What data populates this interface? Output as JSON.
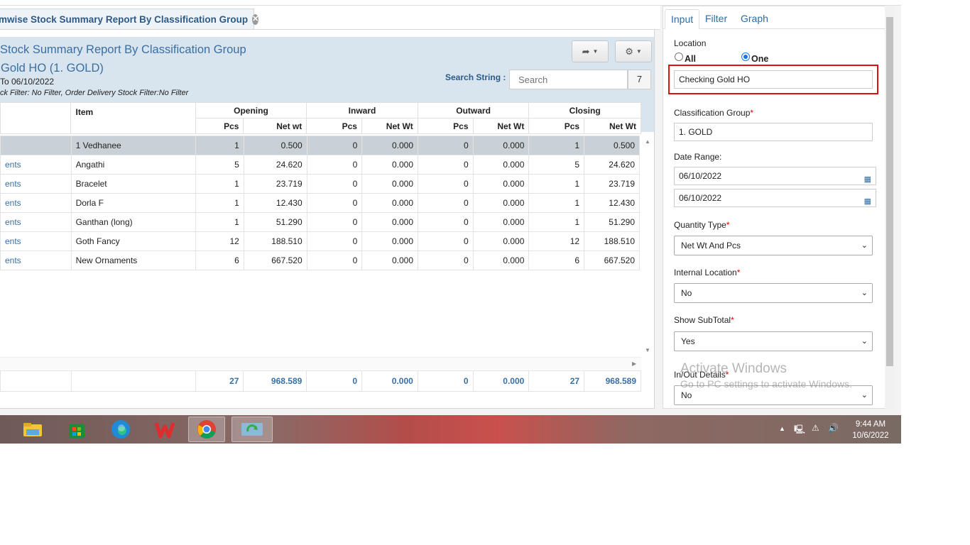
{
  "tab": {
    "label": "mwise Stock Summary Report By Classification Group"
  },
  "report": {
    "title": "Stock Summary Report By Classification Group",
    "subtitle": "Gold HO (1. GOLD)",
    "date_range": "To 06/10/2022",
    "filter_text": "ck Filter: No Filter, Order Delivery Stock Filter:No Filter",
    "search_label": "Search String :",
    "search_placeholder": "Search",
    "search_count": "7"
  },
  "table": {
    "col_item": "Item",
    "groups": [
      "Opening",
      "Inward",
      "Outward",
      "Closing"
    ],
    "sub": {
      "pcs": "Pcs",
      "netwt_opening": "Net wt",
      "netwt": "Net Wt"
    },
    "rows": [
      {
        "group": "",
        "item": "1 Vedhanee",
        "op_pcs": "1",
        "op_wt": "0.500",
        "in_pcs": "0",
        "in_wt": "0.000",
        "out_pcs": "0",
        "out_wt": "0.000",
        "cl_pcs": "1",
        "cl_wt": "0.500"
      },
      {
        "group": "ents",
        "item": "Angathi",
        "op_pcs": "5",
        "op_wt": "24.620",
        "in_pcs": "0",
        "in_wt": "0.000",
        "out_pcs": "0",
        "out_wt": "0.000",
        "cl_pcs": "5",
        "cl_wt": "24.620"
      },
      {
        "group": "ents",
        "item": "Bracelet",
        "op_pcs": "1",
        "op_wt": "23.719",
        "in_pcs": "0",
        "in_wt": "0.000",
        "out_pcs": "0",
        "out_wt": "0.000",
        "cl_pcs": "1",
        "cl_wt": "23.719"
      },
      {
        "group": "ents",
        "item": "Dorla F",
        "op_pcs": "1",
        "op_wt": "12.430",
        "in_pcs": "0",
        "in_wt": "0.000",
        "out_pcs": "0",
        "out_wt": "0.000",
        "cl_pcs": "1",
        "cl_wt": "12.430"
      },
      {
        "group": "ents",
        "item": "Ganthan (long)",
        "op_pcs": "1",
        "op_wt": "51.290",
        "in_pcs": "0",
        "in_wt": "0.000",
        "out_pcs": "0",
        "out_wt": "0.000",
        "cl_pcs": "1",
        "cl_wt": "51.290"
      },
      {
        "group": "ents",
        "item": "Goth Fancy",
        "op_pcs": "12",
        "op_wt": "188.510",
        "in_pcs": "0",
        "in_wt": "0.000",
        "out_pcs": "0",
        "out_wt": "0.000",
        "cl_pcs": "12",
        "cl_wt": "188.510"
      },
      {
        "group": "ents",
        "item": "New Ornaments",
        "op_pcs": "6",
        "op_wt": "667.520",
        "in_pcs": "0",
        "in_wt": "0.000",
        "out_pcs": "0",
        "out_wt": "0.000",
        "cl_pcs": "6",
        "cl_wt": "667.520"
      }
    ],
    "totals": {
      "op_pcs": "27",
      "op_wt": "968.589",
      "in_pcs": "0",
      "in_wt": "0.000",
      "out_pcs": "0",
      "out_wt": "0.000",
      "cl_pcs": "27",
      "cl_wt": "968.589"
    }
  },
  "panel": {
    "tabs": [
      "Input",
      "Filter",
      "Graph"
    ],
    "location_label": "Location",
    "radio_all": "All",
    "radio_one": "One",
    "location_value": "Checking Gold HO",
    "classification_label": "Classification Group",
    "classification_value": "1. GOLD",
    "date_range_label": "Date Range:",
    "date_from": "06/10/2022",
    "date_to": "06/10/2022",
    "quantity_type_label": "Quantity Type",
    "quantity_type_value": "Net Wt And Pcs",
    "internal_location_label": "Internal Location",
    "internal_location_value": "No",
    "show_subtotal_label": "Show SubTotal",
    "show_subtotal_value": "Yes",
    "inout_details_label": "In/Out Details",
    "inout_details_value": "No",
    "required_mark": "*"
  },
  "watermark": {
    "line1": "Activate Windows",
    "line2": "Go to PC settings to activate Windows."
  },
  "taskbar": {
    "time": "9:44 AM",
    "date": "10/6/2022"
  },
  "colors": {
    "accent": "#3a6fa3",
    "header_bg": "#d8e4ee",
    "selected_row": "#c9d1d6",
    "highlight": "#dd1111"
  }
}
